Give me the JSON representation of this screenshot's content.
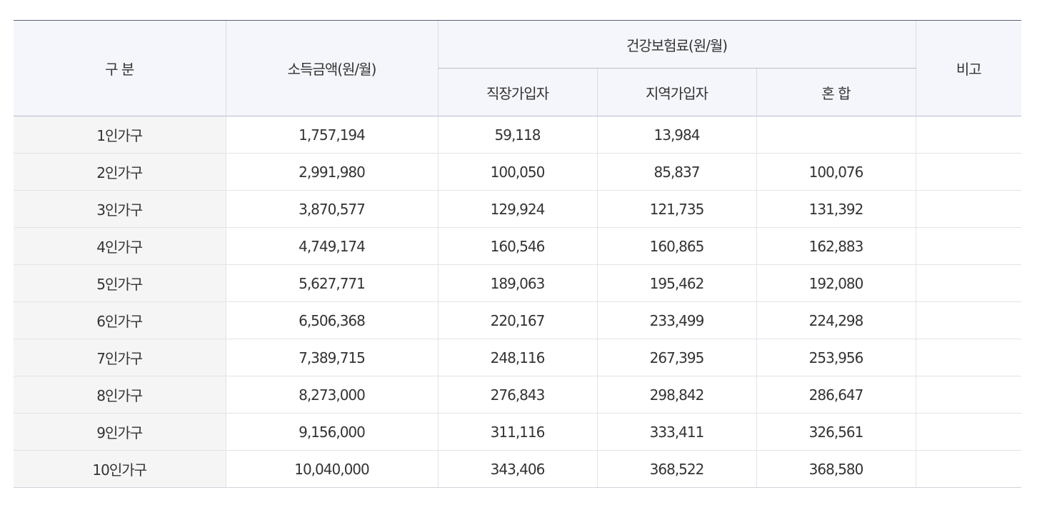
{
  "header": {
    "category": "구 분",
    "income": "소득금액(원/월)",
    "premium_group": "건강보험료(원/월)",
    "employee": "직장가입자",
    "regional": "지역가입자",
    "mixed": "혼 합",
    "note": "비고"
  },
  "rows": [
    {
      "label": "1인가구",
      "income": "1,757,194",
      "employee": "59,118",
      "regional": "13,984",
      "mixed": "",
      "note": ""
    },
    {
      "label": "2인가구",
      "income": "2,991,980",
      "employee": "100,050",
      "regional": "85,837",
      "mixed": "100,076",
      "note": ""
    },
    {
      "label": "3인가구",
      "income": "3,870,577",
      "employee": "129,924",
      "regional": "121,735",
      "mixed": "131,392",
      "note": ""
    },
    {
      "label": "4인가구",
      "income": "4,749,174",
      "employee": "160,546",
      "regional": "160,865",
      "mixed": "162,883",
      "note": ""
    },
    {
      "label": "5인가구",
      "income": "5,627,771",
      "employee": "189,063",
      "regional": "195,462",
      "mixed": "192,080",
      "note": ""
    },
    {
      "label": "6인가구",
      "income": "6,506,368",
      "employee": "220,167",
      "regional": "233,499",
      "mixed": "224,298",
      "note": ""
    },
    {
      "label": "7인가구",
      "income": "7,389,715",
      "employee": "248,116",
      "regional": "267,395",
      "mixed": "253,956",
      "note": ""
    },
    {
      "label": "8인가구",
      "income": "8,273,000",
      "employee": "276,843",
      "regional": "298,842",
      "mixed": "286,647",
      "note": ""
    },
    {
      "label": "9인가구",
      "income": "9,156,000",
      "employee": "311,116",
      "regional": "333,411",
      "mixed": "326,561",
      "note": ""
    },
    {
      "label": "10인가구",
      "income": "10,040,000",
      "employee": "343,406",
      "regional": "368,522",
      "mixed": "368,580",
      "note": ""
    }
  ]
}
